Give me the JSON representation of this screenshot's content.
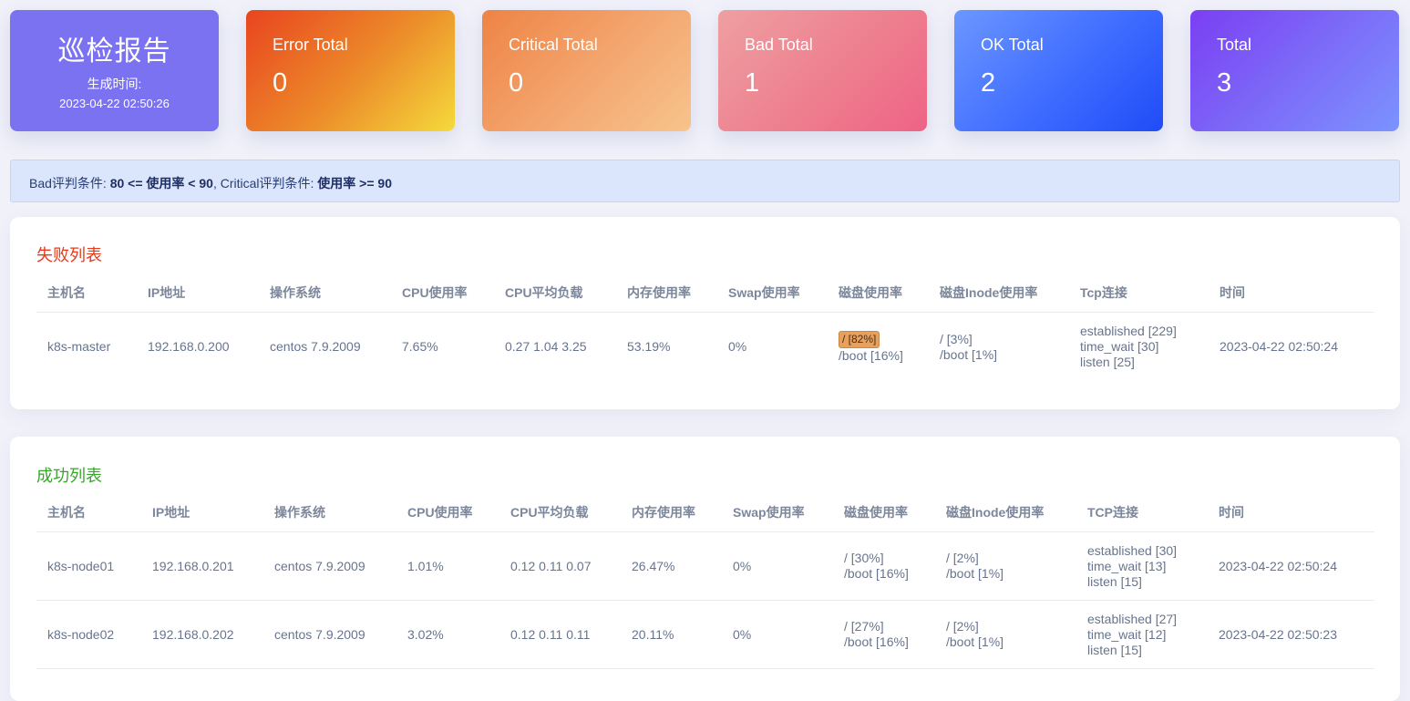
{
  "report": {
    "title": "巡检报告",
    "generated_label": "生成时间:",
    "generated_time": "2023-04-22 02:50:26"
  },
  "stats": [
    {
      "label": "Error Total",
      "value": "0"
    },
    {
      "label": "Critical Total",
      "value": "0"
    },
    {
      "label": "Bad Total",
      "value": "1"
    },
    {
      "label": "OK Total",
      "value": "2"
    },
    {
      "label": "Total",
      "value": "3"
    }
  ],
  "criteria": {
    "bad_label": "Bad评判条件: ",
    "bad_rule": "80 <= 使用率 < 90",
    "sep": ", ",
    "critical_label": "Critical评判条件: ",
    "critical_rule": "使用率 >= 90"
  },
  "fail_section": {
    "title": "失败列表",
    "headers": [
      "主机名",
      "IP地址",
      "操作系统",
      "CPU使用率",
      "CPU平均负载",
      "内存使用率",
      "Swap使用率",
      "磁盘使用率",
      "磁盘Inode使用率",
      "Tcp连接",
      "时间"
    ],
    "rows": [
      {
        "hostname": "k8s-master",
        "ip": "192.168.0.200",
        "os": "centos 7.9.2009",
        "cpu": "7.65%",
        "load": "0.27 1.04 3.25",
        "mem": "53.19%",
        "swap": "0%",
        "disk_warn": "/ [82%]",
        "disk": [
          "/boot [16%]"
        ],
        "inode": [
          "/ [3%]",
          "/boot [1%]"
        ],
        "tcp": [
          "established [229]",
          "time_wait [30]",
          "listen [25]"
        ],
        "time": "2023-04-22 02:50:24"
      }
    ]
  },
  "ok_section": {
    "title": "成功列表",
    "headers": [
      "主机名",
      "IP地址",
      "操作系统",
      "CPU使用率",
      "CPU平均负载",
      "内存使用率",
      "Swap使用率",
      "磁盘使用率",
      "磁盘Inode使用率",
      "TCP连接",
      "时间"
    ],
    "rows": [
      {
        "hostname": "k8s-node01",
        "ip": "192.168.0.201",
        "os": "centos 7.9.2009",
        "cpu": "1.01%",
        "load": "0.12 0.11 0.07",
        "mem": "26.47%",
        "swap": "0%",
        "disk": [
          "/ [30%]",
          "/boot [16%]"
        ],
        "inode": [
          "/ [2%]",
          "/boot [1%]"
        ],
        "tcp": [
          "established [30]",
          "time_wait [13]",
          "listen [15]"
        ],
        "time": "2023-04-22 02:50:24"
      },
      {
        "hostname": "k8s-node02",
        "ip": "192.168.0.202",
        "os": "centos 7.9.2009",
        "cpu": "3.02%",
        "load": "0.12 0.11 0.11",
        "mem": "20.11%",
        "swap": "0%",
        "disk": [
          "/ [27%]",
          "/boot [16%]"
        ],
        "inode": [
          "/ [2%]",
          "/boot [1%]"
        ],
        "tcp": [
          "established [27]",
          "time_wait [12]",
          "listen [15]"
        ],
        "time": "2023-04-22 02:50:23"
      }
    ]
  }
}
